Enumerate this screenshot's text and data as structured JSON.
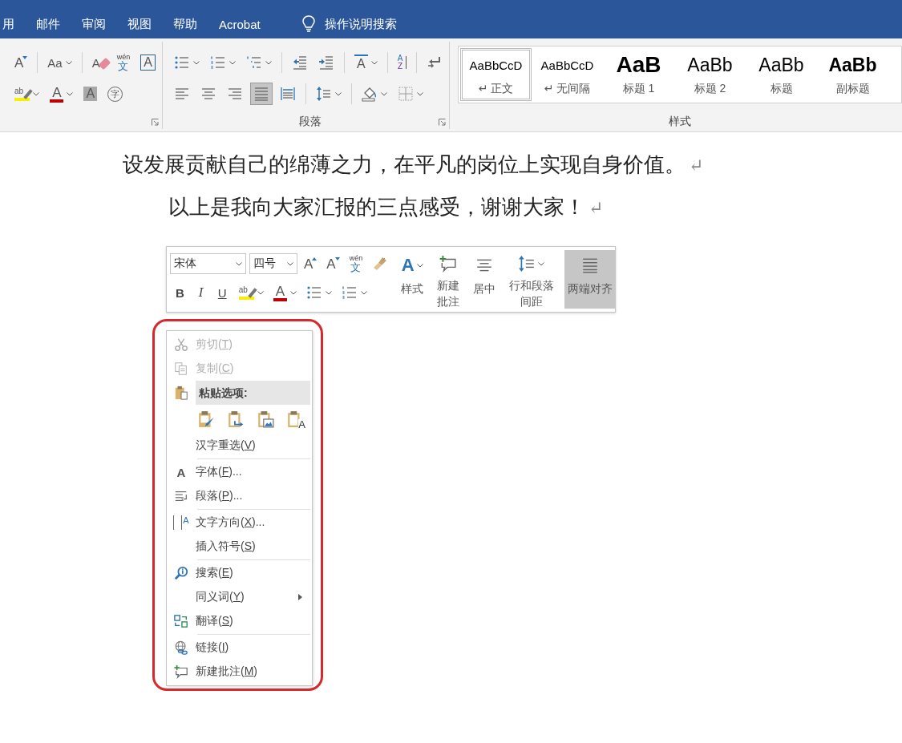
{
  "tabs": [
    {
      "label": "用",
      "selected": false
    },
    {
      "label": "邮件",
      "selected": false
    },
    {
      "label": "审阅",
      "selected": false
    },
    {
      "label": "视图",
      "selected": false
    },
    {
      "label": "帮助",
      "selected": false
    },
    {
      "label": "Acrobat",
      "selected": false
    }
  ],
  "tell_me": {
    "label": "操作说明搜索"
  },
  "ribbon": {
    "font_group": {
      "row1": [
        {
          "kind": "shrink-font",
          "glyph": "A",
          "dropdown": false
        },
        {
          "kind": "separator"
        },
        {
          "kind": "change-case",
          "glyph": "Aa",
          "dropdown": true
        },
        {
          "kind": "separator"
        },
        {
          "kind": "clear-format",
          "glyph": "A",
          "dropdown": false
        },
        {
          "kind": "phonetic",
          "glyph": "wén",
          "glyph2": "文",
          "dropdown": false
        },
        {
          "kind": "char-border",
          "glyph": "A",
          "dropdown": false
        }
      ],
      "row2": [
        {
          "kind": "highlight",
          "glyph": "ab",
          "dropdown": true
        },
        {
          "kind": "font-color",
          "glyph": "A",
          "dropdown": true
        },
        {
          "kind": "char-shading",
          "glyph": "A",
          "dropdown": false
        },
        {
          "kind": "enclose",
          "glyph": "字",
          "dropdown": false
        }
      ]
    },
    "paragraph_group": {
      "label": "段落",
      "row1": [
        {
          "kind": "bullets",
          "dropdown": true
        },
        {
          "kind": "numbering",
          "dropdown": true
        },
        {
          "kind": "multilevel",
          "dropdown": true
        },
        {
          "kind": "separator"
        },
        {
          "kind": "decrease-indent",
          "dropdown": false
        },
        {
          "kind": "increase-indent",
          "dropdown": false
        },
        {
          "kind": "separator"
        },
        {
          "kind": "chinese-layout",
          "glyph": "A",
          "dropdown": true
        },
        {
          "kind": "separator"
        },
        {
          "kind": "sort",
          "glyph": "A",
          "glyph2": "Z",
          "dropdown": false
        },
        {
          "kind": "separator"
        },
        {
          "kind": "show-marks",
          "dropdown": false
        }
      ],
      "row2": [
        {
          "kind": "align-left",
          "dropdown": false,
          "selected": false
        },
        {
          "kind": "align-center",
          "dropdown": false,
          "selected": false
        },
        {
          "kind": "align-right",
          "dropdown": false,
          "selected": false
        },
        {
          "kind": "justify",
          "dropdown": false,
          "selected": true
        },
        {
          "kind": "distributed",
          "dropdown": false,
          "selected": false
        },
        {
          "kind": "separator"
        },
        {
          "kind": "line-spacing",
          "dropdown": true
        },
        {
          "kind": "separator"
        },
        {
          "kind": "shading",
          "dropdown": true
        },
        {
          "kind": "borders",
          "dropdown": true
        }
      ]
    },
    "styles_group": {
      "label": "样式",
      "styles": [
        {
          "sample": "AaBbCcD",
          "name": "↵ 正文",
          "kind": "normal",
          "selected": true
        },
        {
          "sample": "AaBbCcD",
          "name": "↵ 无间隔",
          "kind": "normal",
          "selected": false
        },
        {
          "sample": "AaB",
          "name": "标题 1",
          "kind": "heading1",
          "selected": false
        },
        {
          "sample": "AaBb",
          "name": "标题 2",
          "kind": "heading2",
          "selected": false
        },
        {
          "sample": "AaBb",
          "name": "标题",
          "kind": "title",
          "selected": false
        },
        {
          "sample": "AaBb",
          "name": "副标题",
          "kind": "subtitle",
          "selected": false
        }
      ]
    }
  },
  "document": {
    "paragraphs": [
      {
        "text": "设发展贡献自己的绵薄之力，在平凡的岗位上实现自身价值。",
        "mark": "↵",
        "indent": false
      },
      {
        "text": "以上是我向大家汇报的三点感受，谢谢大家！",
        "mark": "↵",
        "indent": true
      }
    ]
  },
  "mini_toolbar": {
    "font": {
      "value": "宋体"
    },
    "size": {
      "value": "四号"
    },
    "row1": [
      {
        "kind": "grow-font",
        "glyph": "A",
        "dropdown": false
      },
      {
        "kind": "shrink-font",
        "glyph": "A",
        "dropdown": false
      },
      {
        "kind": "phonetic",
        "glyph": "wén",
        "glyph2": "文",
        "dropdown": false
      },
      {
        "kind": "format-painter",
        "dropdown": false
      }
    ],
    "row2": [
      {
        "kind": "bold",
        "glyph": "B",
        "dropdown": false
      },
      {
        "kind": "italic",
        "glyph": "I",
        "dropdown": false
      },
      {
        "kind": "underline",
        "glyph": "U",
        "dropdown": false
      },
      {
        "kind": "highlight",
        "glyph": "ab",
        "dropdown": true
      },
      {
        "kind": "font-color",
        "glyph": "A",
        "dropdown": true
      },
      {
        "kind": "bullets",
        "dropdown": true
      },
      {
        "kind": "numbering",
        "dropdown": true
      }
    ],
    "big_buttons": [
      {
        "kind": "styles",
        "glyph": "A",
        "label": "样式",
        "dropdown": true,
        "selected": false
      },
      {
        "kind": "comment",
        "label": "新建批注",
        "dropdown": false,
        "selected": false
      },
      {
        "kind": "align-center",
        "label": "居中",
        "dropdown": false,
        "selected": false
      },
      {
        "kind": "line-spacing",
        "label": "行和段落间距",
        "dropdown": true,
        "selected": false
      },
      {
        "kind": "justify",
        "label": "两端对齐",
        "dropdown": false,
        "selected": true
      }
    ]
  },
  "context_menu": {
    "items": [
      {
        "kind": "scissors",
        "label": "剪切(",
        "access_key": "T",
        "label_end": ")",
        "disabled": true,
        "submenu": false
      },
      {
        "kind": "copy",
        "label": "复制(",
        "access_key": "C",
        "label_end": ")",
        "disabled": true,
        "submenu": false
      },
      {
        "kind": "header",
        "label": "粘贴选项:"
      },
      {
        "kind": "paste-options",
        "options": [
          {
            "kind": "paste-keep"
          },
          {
            "kind": "paste-merge"
          },
          {
            "kind": "paste-picture"
          },
          {
            "kind": "paste-text",
            "glyph": "A"
          }
        ]
      },
      {
        "kind": "plain",
        "label": "汉字重选(",
        "access_key": "V",
        "label_end": ")",
        "disabled": false,
        "submenu": false
      },
      {
        "kind": "separator"
      },
      {
        "kind": "font",
        "glyph": "A",
        "label": "字体(",
        "access_key": "F",
        "label_end": ")...",
        "disabled": false,
        "submenu": false
      },
      {
        "kind": "paragraph",
        "label": "段落(",
        "access_key": "P",
        "label_end": ")...",
        "disabled": false,
        "submenu": false
      },
      {
        "kind": "separator"
      },
      {
        "kind": "text-direction",
        "glyph": "A",
        "label": "文字方向(",
        "access_key": "X",
        "label_end": ")...",
        "disabled": false,
        "submenu": false
      },
      {
        "kind": "plain",
        "label": "插入符号(",
        "access_key": "S",
        "label_end": ")",
        "disabled": false,
        "submenu": false
      },
      {
        "kind": "separator"
      },
      {
        "kind": "search",
        "label": "搜索(",
        "access_key": "E",
        "label_end": ")",
        "disabled": false,
        "submenu": false
      },
      {
        "kind": "plain",
        "label": "同义词(",
        "access_key": "Y",
        "label_end": ")",
        "disabled": false,
        "submenu": true
      },
      {
        "kind": "translate",
        "label": "翻译(",
        "access_key": "S",
        "label_end": ")",
        "disabled": false,
        "submenu": false
      },
      {
        "kind": "separator"
      },
      {
        "kind": "link",
        "label": "链接(",
        "access_key": "I",
        "label_end": ")",
        "disabled": false,
        "submenu": false
      },
      {
        "kind": "comment",
        "label": "新建批注(",
        "access_key": "M",
        "label_end": ")",
        "disabled": false,
        "submenu": false
      }
    ]
  }
}
